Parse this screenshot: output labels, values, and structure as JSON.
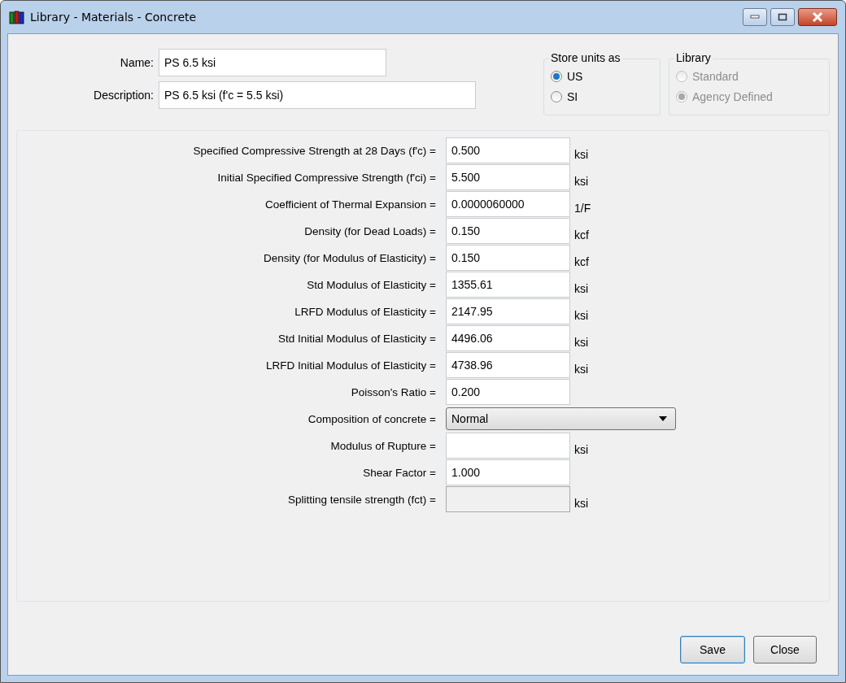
{
  "window": {
    "title": "Library - Materials - Concrete"
  },
  "name": {
    "label": "Name:",
    "value": "PS 6.5 ksi"
  },
  "description": {
    "label": "Description:",
    "value": "PS 6.5 ksi (f'c = 5.5 ksi)"
  },
  "radio_groups": [
    {
      "title": "Store units as",
      "options": [
        {
          "label": "US",
          "selected": true,
          "disabled": false
        },
        {
          "label": "SI",
          "selected": false,
          "disabled": false
        }
      ]
    },
    {
      "title": "Library",
      "options": [
        {
          "label": "Standard",
          "selected": false,
          "disabled": true
        },
        {
          "label": "Agency Defined",
          "selected": true,
          "disabled": true
        }
      ]
    }
  ],
  "fields": [
    {
      "kind": "input",
      "label": "Specified Compressive Strength at 28 Days (f'c) =",
      "value": "0.500",
      "unit": "ksi",
      "disabled": false
    },
    {
      "kind": "input",
      "label": "Initial Specified Compressive Strength (f'ci) =",
      "value": "5.500",
      "unit": "ksi",
      "disabled": false
    },
    {
      "kind": "input",
      "label": "Coefficient of Thermal Expansion =",
      "value": "0.0000060000",
      "unit": "1/F",
      "disabled": false
    },
    {
      "kind": "input",
      "label": "Density (for Dead Loads) =",
      "value": "0.150",
      "unit": "kcf",
      "disabled": false
    },
    {
      "kind": "input",
      "label": "Density (for Modulus of Elasticity) =",
      "value": "0.150",
      "unit": "kcf",
      "disabled": false
    },
    {
      "kind": "input",
      "label": "Std Modulus of Elasticity =",
      "value": "1355.61",
      "unit": "ksi",
      "disabled": false
    },
    {
      "kind": "input",
      "label": "LRFD Modulus of Elasticity =",
      "value": "2147.95",
      "unit": "ksi",
      "disabled": false
    },
    {
      "kind": "input",
      "label": "Std Initial Modulus of Elasticity =",
      "value": "4496.06",
      "unit": "ksi",
      "disabled": false
    },
    {
      "kind": "input",
      "label": "LRFD Initial Modulus of Elasticity =",
      "value": "4738.96",
      "unit": "ksi",
      "disabled": false
    },
    {
      "kind": "input",
      "label": "Poisson's Ratio =",
      "value": "0.200",
      "disabled": false
    },
    {
      "kind": "select",
      "label": "Composition of concrete =",
      "value": "Normal",
      "disabled": false
    },
    {
      "kind": "input",
      "label": "Modulus of Rupture =",
      "unit": "ksi",
      "disabled": false
    },
    {
      "kind": "input",
      "label": "Shear Factor =",
      "value": "1.000",
      "disabled": false
    },
    {
      "kind": "input",
      "label": "Splitting tensile strength (fct) =",
      "unit": "ksi",
      "disabled": true
    }
  ],
  "buttons": [
    {
      "label": "Save",
      "default": true
    },
    {
      "label": "Close",
      "default": false
    }
  ]
}
